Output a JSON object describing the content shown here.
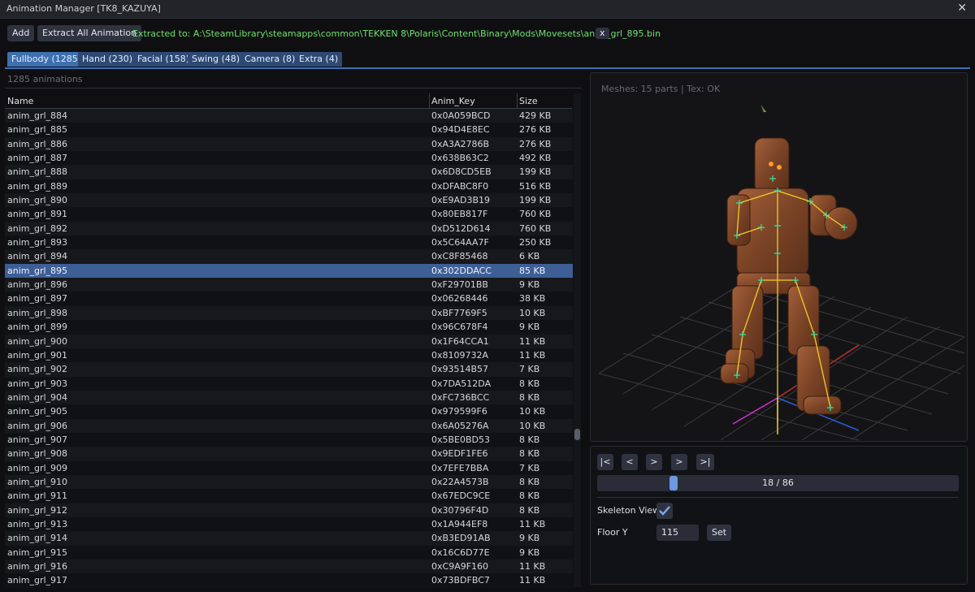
{
  "window": {
    "title": "Animation Manager  [TK8_KAZUYA]",
    "close_label": "✕"
  },
  "toolbar": {
    "add_label": "Add",
    "extract_label": "Extract All Animation",
    "extracted_text": "Extracted to: A:\\SteamLibrary\\steamapps\\common\\TEKKEN 8\\Polaris\\Content\\Binary\\Mods\\Movesets\\anim_grl_895.bin",
    "dismiss_label": "x"
  },
  "tabs": [
    {
      "label": "Fullbody (1285)",
      "active": true
    },
    {
      "label": "Hand (230)",
      "active": false
    },
    {
      "label": "Facial (158)",
      "active": false
    },
    {
      "label": "Swing (48)",
      "active": false
    },
    {
      "label": "Camera (8)",
      "active": false
    },
    {
      "label": "Extra (4)",
      "active": false
    }
  ],
  "list": {
    "count_text": "1285 animations",
    "columns": [
      "Name",
      "Anim_Key",
      "Size"
    ],
    "selected": "anim_grl_895",
    "rows": [
      [
        "anim_grl_884",
        "0x0A059BCD",
        "429 KB"
      ],
      [
        "anim_grl_885",
        "0x94D4E8EC",
        "276 KB"
      ],
      [
        "anim_grl_886",
        "0xA3A2786B",
        "276 KB"
      ],
      [
        "anim_grl_887",
        "0x638B63C2",
        "492 KB"
      ],
      [
        "anim_grl_888",
        "0x6D8CD5EB",
        "199 KB"
      ],
      [
        "anim_grl_889",
        "0xDFABC8F0",
        "516 KB"
      ],
      [
        "anim_grl_890",
        "0xE9AD3B19",
        "199 KB"
      ],
      [
        "anim_grl_891",
        "0x80EB817F",
        "760 KB"
      ],
      [
        "anim_grl_892",
        "0xD512D614",
        "760 KB"
      ],
      [
        "anim_grl_893",
        "0x5C64AA7F",
        "250 KB"
      ],
      [
        "anim_grl_894",
        "0xC8F85468",
        "6 KB"
      ],
      [
        "anim_grl_895",
        "0x302DDACC",
        "85 KB"
      ],
      [
        "anim_grl_896",
        "0xF29701BB",
        "9 KB"
      ],
      [
        "anim_grl_897",
        "0x06268446",
        "38 KB"
      ],
      [
        "anim_grl_898",
        "0xBF7769F5",
        "10 KB"
      ],
      [
        "anim_grl_899",
        "0x96C678F4",
        "9 KB"
      ],
      [
        "anim_grl_900",
        "0x1F64CCA1",
        "11 KB"
      ],
      [
        "anim_grl_901",
        "0x8109732A",
        "11 KB"
      ],
      [
        "anim_grl_902",
        "0x93514B57",
        "7 KB"
      ],
      [
        "anim_grl_903",
        "0x7DA512DA",
        "8 KB"
      ],
      [
        "anim_grl_904",
        "0xFC736BCC",
        "8 KB"
      ],
      [
        "anim_grl_905",
        "0x979599F6",
        "10 KB"
      ],
      [
        "anim_grl_906",
        "0x6A05276A",
        "10 KB"
      ],
      [
        "anim_grl_907",
        "0x5BE0BD53",
        "8 KB"
      ],
      [
        "anim_grl_908",
        "0x9EDF1FE6",
        "8 KB"
      ],
      [
        "anim_grl_909",
        "0x7EFE7BBA",
        "7 KB"
      ],
      [
        "anim_grl_910",
        "0x22A4573B",
        "8 KB"
      ],
      [
        "anim_grl_911",
        "0x67EDC9CE",
        "8 KB"
      ],
      [
        "anim_grl_912",
        "0x30796F4D",
        "8 KB"
      ],
      [
        "anim_grl_913",
        "0x1A944EF8",
        "11 KB"
      ],
      [
        "anim_grl_914",
        "0xB3ED91AB",
        "9 KB"
      ],
      [
        "anim_grl_915",
        "0x16C6D77E",
        "9 KB"
      ],
      [
        "anim_grl_916",
        "0xC9A9F160",
        "11 KB"
      ],
      [
        "anim_grl_917",
        "0x73BDFBC7",
        "11 KB"
      ]
    ]
  },
  "viewport": {
    "mesh_info": "Meshes: 15 parts | Tex: OK"
  },
  "playback": {
    "first_label": "|<",
    "prev_label": "<",
    "play_label": ">",
    "next_label": ">",
    "last_label": ">|",
    "frame_text": "18 / 86",
    "frame_current": 18,
    "frame_total": 86,
    "skeleton_label": "Skeleton View",
    "skeleton_checked": true,
    "floor_label": "Floor Y",
    "floor_value": "115",
    "set_label": "Set"
  },
  "colors": {
    "accent": "#3e6fb1",
    "selected_row": "#3e5f96",
    "success_text": "#6be36b",
    "bone": "#f0d020",
    "joint": "#40e0a0"
  }
}
